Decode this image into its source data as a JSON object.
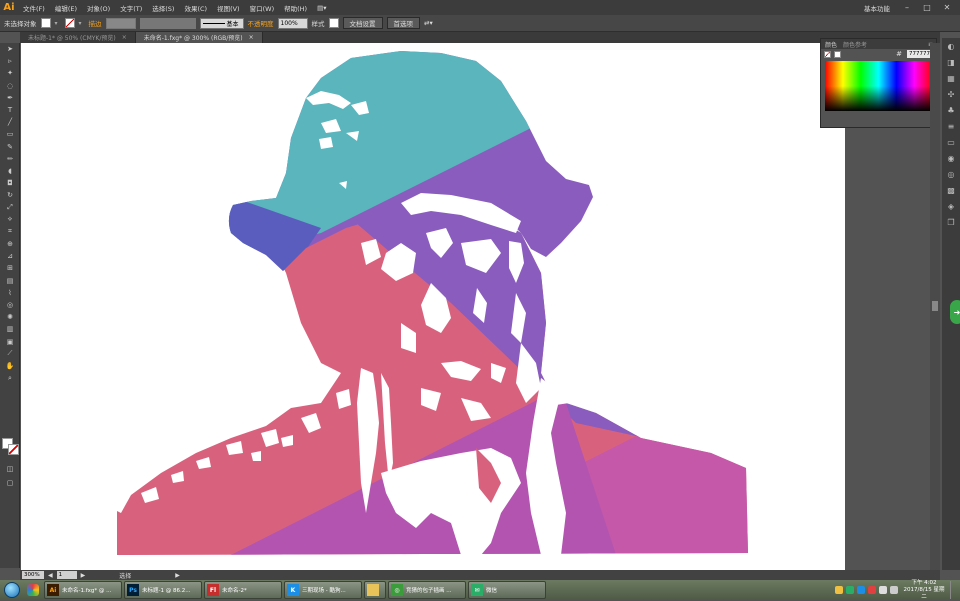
{
  "app": {
    "logo": "Ai",
    "menus": [
      "文件(F)",
      "编辑(E)",
      "对象(O)",
      "文字(T)",
      "选择(S)",
      "效果(C)",
      "视图(V)",
      "窗口(W)",
      "帮助(H)"
    ],
    "workspace": "基本功能",
    "winctrl": [
      "–",
      "□",
      "✕"
    ]
  },
  "control": {
    "selection": "未选择对象",
    "stroke_label": "描边",
    "stroke_style": "基本",
    "opacity_label": "不透明度",
    "opacity_value": "100%",
    "style_label": "样式",
    "doc_setup": "文档设置",
    "prefs": "首选项"
  },
  "tabs": [
    {
      "label": "未标题-1* @ 50% (CMYK/预览)",
      "close": "×",
      "active": false
    },
    {
      "label": "未命名-1.fxg* @ 300% (RGB/预览)",
      "close": "×",
      "active": true
    }
  ],
  "color_panel": {
    "tab1": "颜色",
    "tab2": "颜色参考",
    "hash": "#",
    "hex": "777777"
  },
  "status": {
    "zoom": "300%",
    "page": "1",
    "tool": "选择"
  },
  "taskbar": {
    "items": [
      {
        "icon": "Ai",
        "label": "未命名-1.fxg* @ ...",
        "color": "#f7a21b",
        "bg": "#3b1c00"
      },
      {
        "icon": "Ps",
        "label": "未标题-1 @ 86.2...",
        "color": "#31a8ff",
        "bg": "#001e36"
      },
      {
        "icon": "Fl",
        "label": "未命名-2*",
        "color": "#fff",
        "bg": "#c62d2d"
      },
      {
        "icon": "K",
        "label": "三期现场 - 酷狗...",
        "color": "#fff",
        "bg": "#1d8ee6"
      },
      {
        "icon": "",
        "label": "",
        "color": "#fff",
        "bg": "#e8c35a"
      },
      {
        "icon": "◎",
        "label": "竞猜的包子插画 ...",
        "color": "#fff",
        "bg": "#3a9c3a"
      },
      {
        "icon": "✉",
        "label": "微信",
        "color": "#fff",
        "bg": "#2aae67"
      }
    ],
    "clock_time": "下午 4:02",
    "clock_date": "2017/8/15 星期二"
  },
  "artwork": {
    "hat_color": "#5ab5bd",
    "purple": "#8a5cbe",
    "blue": "#5b5dbe",
    "pink": "#d8627e",
    "magenta": "#c558a8"
  }
}
